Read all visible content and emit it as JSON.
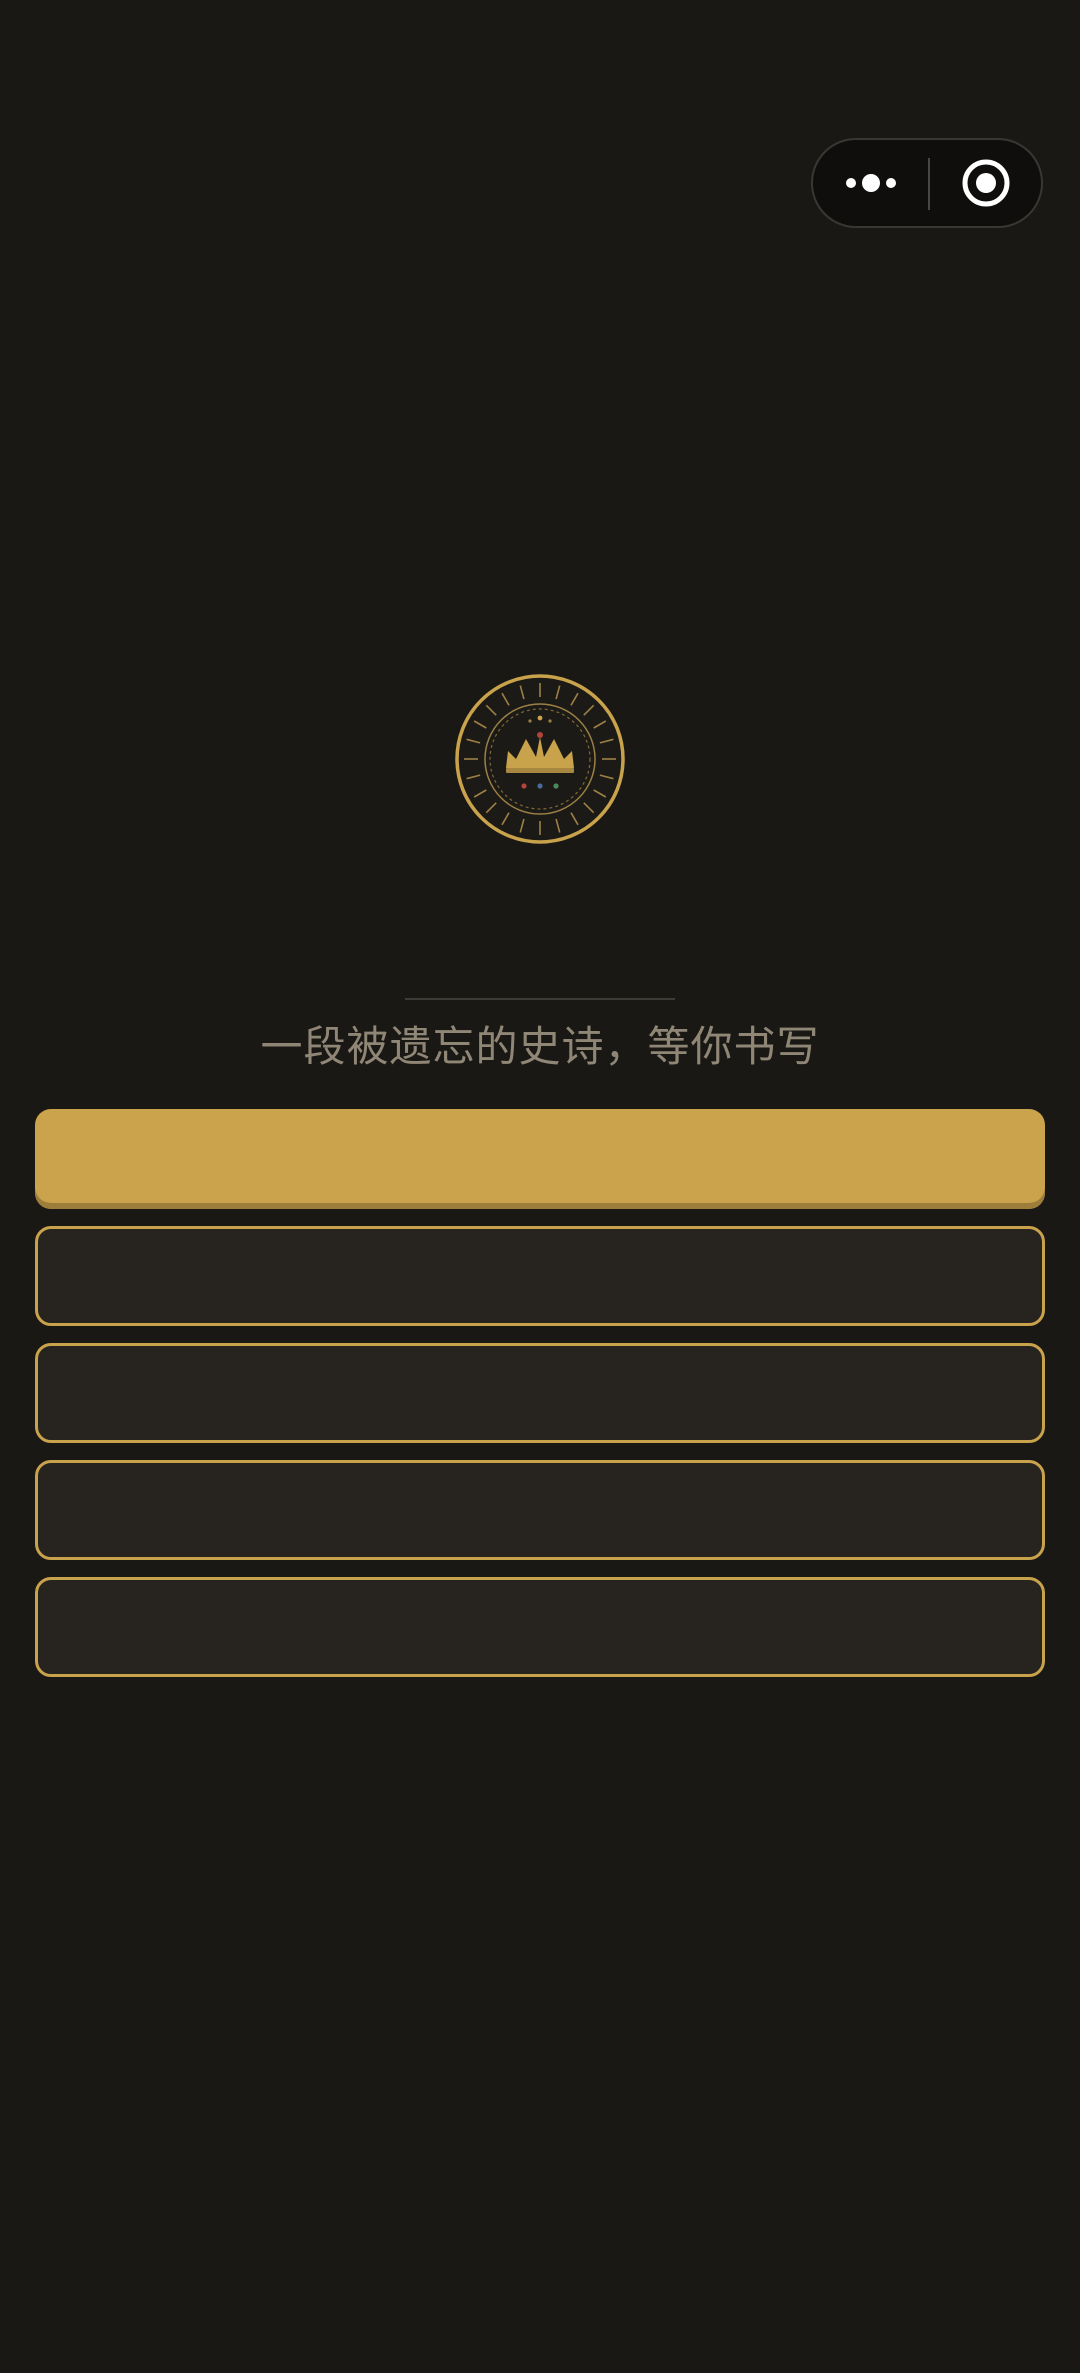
{
  "capsule": {
    "more_icon": "more-dots-icon",
    "close_icon": "target-close-icon"
  },
  "emblem": {
    "icon": "crown-emblem-icon",
    "colors": {
      "gold": "#c9a24c",
      "red": "#b2453a",
      "green": "#4c8a5a",
      "blue": "#4a6a9a"
    }
  },
  "intro": {
    "subtitle": "一段被遗忘的史诗，等你书写"
  },
  "menu": {
    "buttons": [
      {
        "label": ""
      },
      {
        "label": ""
      },
      {
        "label": ""
      },
      {
        "label": ""
      },
      {
        "label": ""
      }
    ]
  },
  "theme": {
    "background": "#1a1815",
    "accent": "#cba34c",
    "button_fill": "#27241f",
    "text_muted": "#8f8676"
  }
}
